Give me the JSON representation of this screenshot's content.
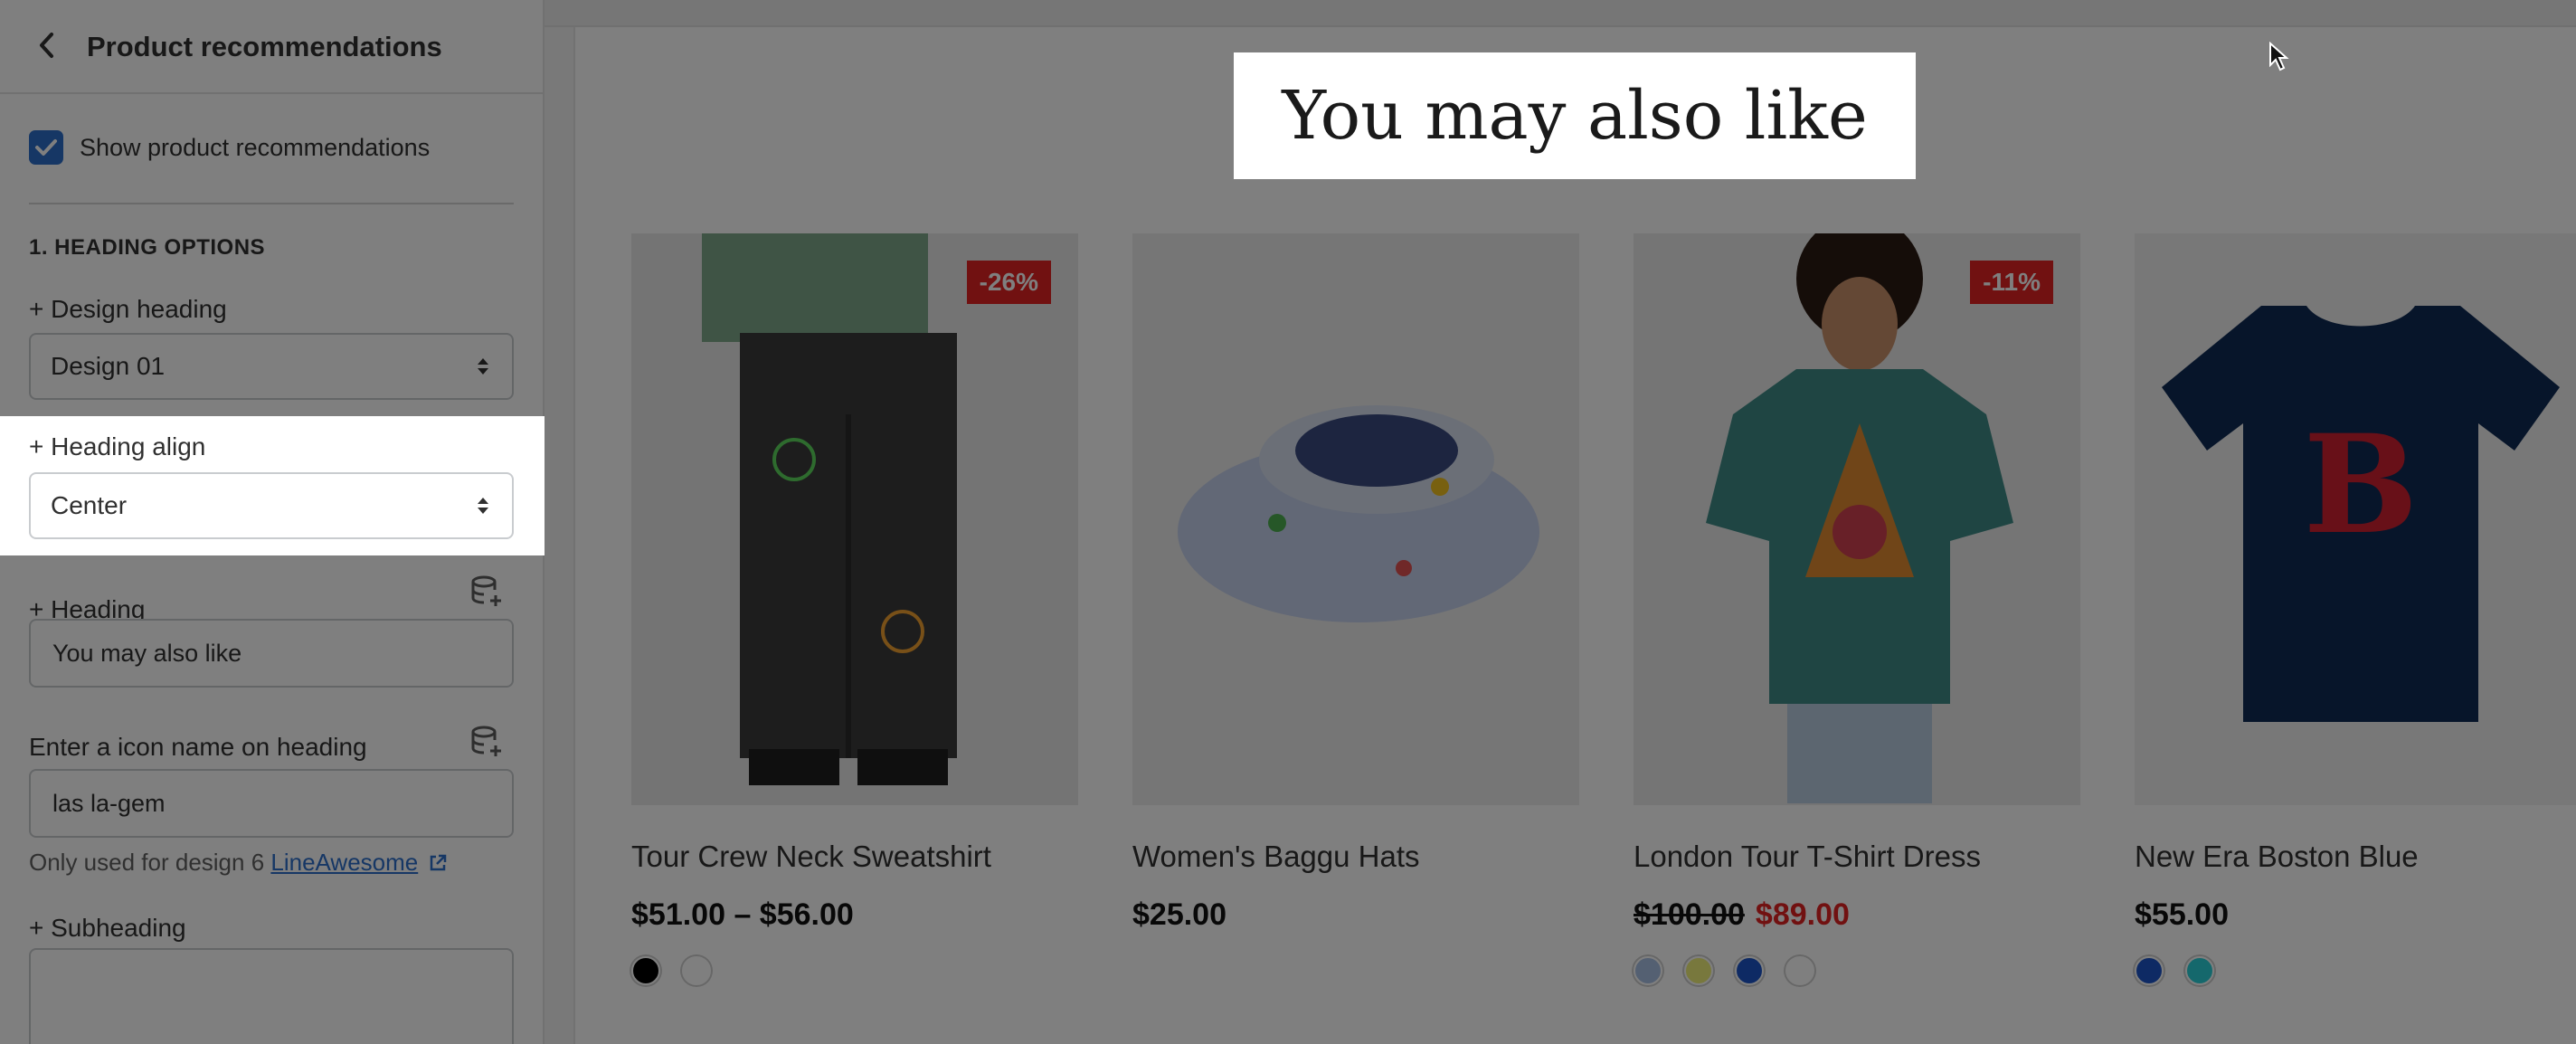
{
  "sidebar": {
    "title": "Product recommendations",
    "show_recommendations_label": "Show product recommendations",
    "section_heading_options": "1. HEADING OPTIONS",
    "design_heading_label": "+ Design heading",
    "design_heading_value": "Design 01",
    "heading_align_label": "+ Heading align",
    "heading_align_value": "Center",
    "heading_label": "+ Heading",
    "heading_value": "You may also like",
    "icon_name_label": "Enter a icon name on heading",
    "icon_name_value": "las la-gem",
    "icon_help_text": "Only used for design 6 ",
    "icon_help_link": "LineAwesome",
    "subheading_label": "+ Subheading"
  },
  "preview": {
    "heading": "You may also like",
    "products": [
      {
        "name": "Tour Crew Neck Sweatshirt",
        "price": "$51.00 – $56.00",
        "badge": "-26%",
        "swatches": [
          "#000000",
          "#ffffff"
        ]
      },
      {
        "name": "Women's Baggu Hats",
        "price": "$25.00",
        "swatches": []
      },
      {
        "name": "London Tour T-Shirt Dress",
        "price_old": "$100.00",
        "price_sale": "$89.00",
        "badge": "-11%",
        "swatches": [
          "#a8c0e4",
          "#f0f07a",
          "#1c54c8",
          "#ffffff"
        ]
      },
      {
        "name": "New Era Boston Blue",
        "price": "$55.00",
        "swatches": [
          "#1c54c8",
          "#2ad1d8"
        ]
      }
    ]
  },
  "colors": {
    "accent": "#2c6ecb",
    "sale": "#e22222",
    "overlay": "rgba(0,0,0,0.5)"
  },
  "icons": [
    "back-chevron-icon",
    "checkbox-check-icon",
    "select-arrows-icon",
    "dynamic-source-icon",
    "external-link-icon",
    "chevron-up-icon",
    "mouse-cursor-icon"
  ]
}
